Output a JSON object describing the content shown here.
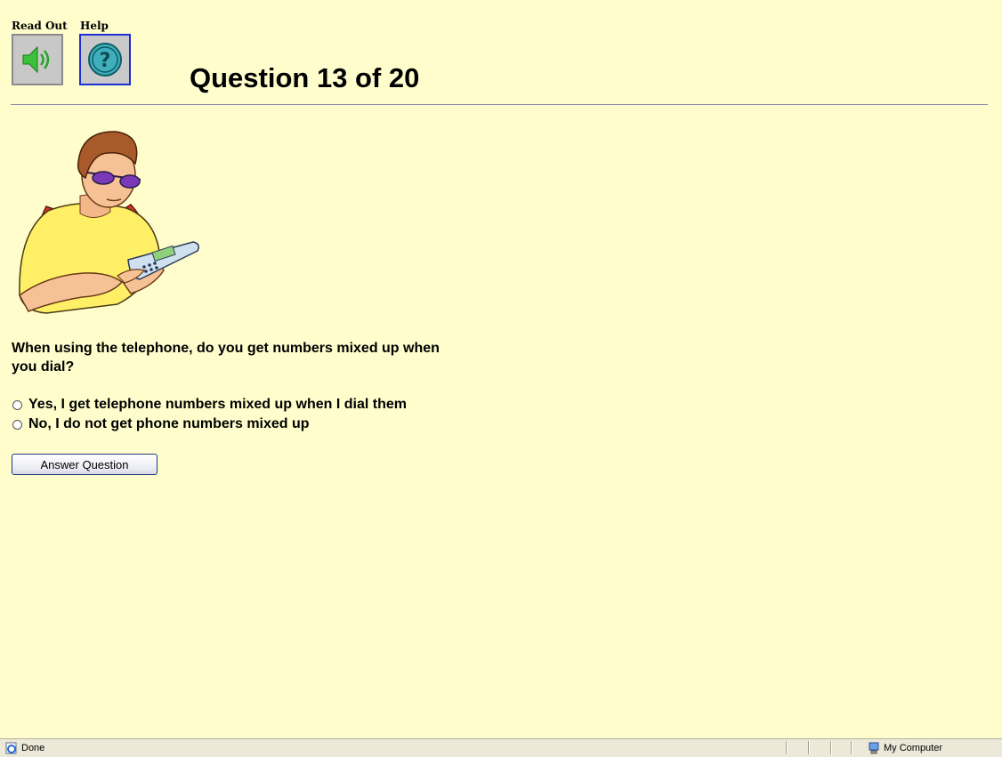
{
  "toolbar": {
    "read_out_label": "Read Out",
    "help_label": "Help"
  },
  "page": {
    "title": "Question 13 of 20"
  },
  "question": {
    "text": "When using the telephone, do you get numbers mixed up when you dial?",
    "options": [
      "Yes, I get telephone numbers mixed up when I dial them",
      "No, I do not get phone numbers mixed up"
    ],
    "submit_label": "Answer Question"
  },
  "statusbar": {
    "left_text": "Done",
    "zone_text": "My Computer"
  },
  "icons": {
    "read_out": "speaker-icon",
    "help": "help-icon",
    "status_page": "ie-page-icon",
    "zone": "my-computer-icon"
  },
  "colors": {
    "background": "#fffdcc",
    "speaker_green": "#39c13a",
    "help_teal": "#1e8d99",
    "help_border": "#1e2fd8"
  }
}
